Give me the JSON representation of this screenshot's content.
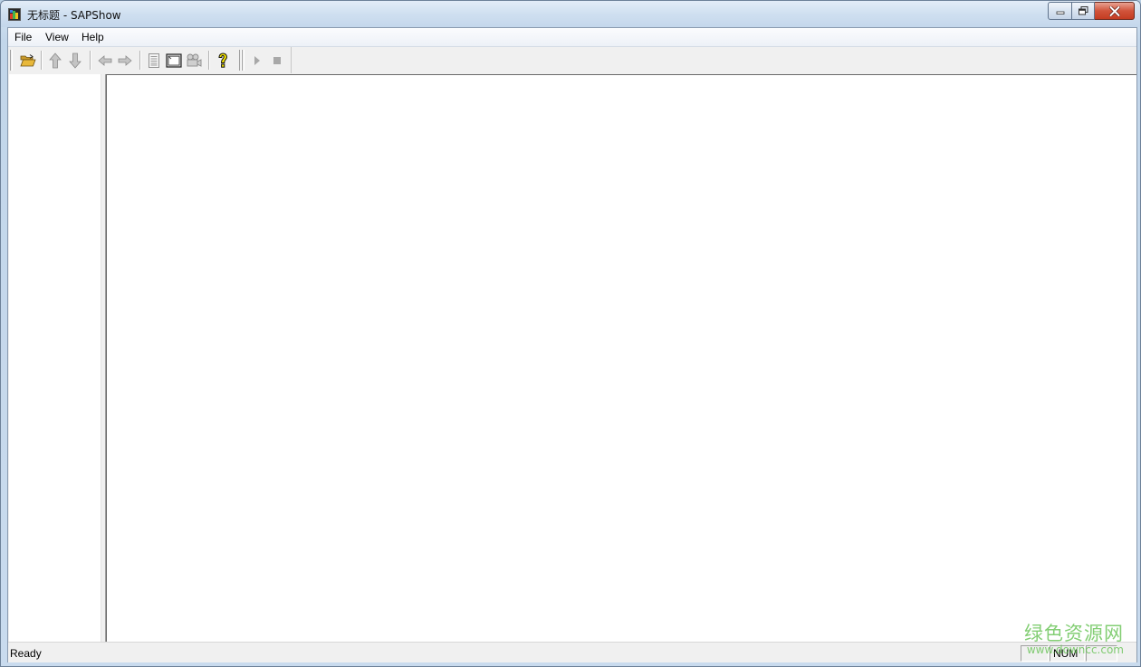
{
  "window": {
    "title": "无标题 - SAPShow",
    "icons": [
      "app-icon",
      "minimize-icon",
      "maximize-icon",
      "close-icon"
    ]
  },
  "menu": {
    "items": [
      {
        "label": "File"
      },
      {
        "label": "View"
      },
      {
        "label": "Help"
      }
    ]
  },
  "toolbar": {
    "buttons": [
      {
        "icon": "open-folder-icon",
        "enabled": true
      },
      {
        "icon": "arrow-up-icon",
        "enabled": false
      },
      {
        "icon": "arrow-down-icon",
        "enabled": false
      },
      {
        "icon": "arrow-left-icon",
        "enabled": false
      },
      {
        "icon": "arrow-right-icon",
        "enabled": false
      },
      {
        "icon": "document-icon",
        "enabled": false
      },
      {
        "icon": "fullscreen-icon",
        "enabled": true
      },
      {
        "icon": "camera-icon",
        "enabled": false
      },
      {
        "icon": "help-icon",
        "enabled": true
      },
      {
        "icon": "play-icon",
        "enabled": false
      },
      {
        "icon": "stop-icon",
        "enabled": false
      }
    ]
  },
  "statusbar": {
    "text": "Ready",
    "panels": [
      "",
      "NUM",
      ""
    ]
  },
  "watermark": {
    "main": "绿色资源网",
    "sub": "www.downcc.com"
  },
  "colors": {
    "close_button": "#c43c22",
    "open_folder": "#e8b83a",
    "help": "#f2e200",
    "disabled": "#9a9a9a",
    "watermark": "#5abe46"
  }
}
